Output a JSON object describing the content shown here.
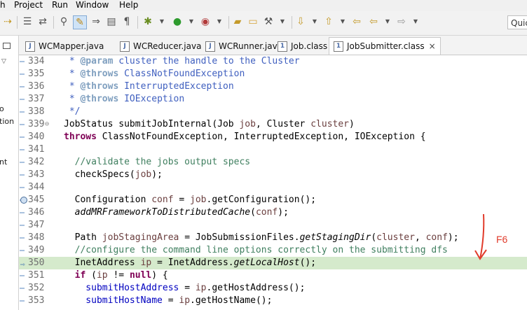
{
  "menu": [
    "h",
    "Project",
    "Run",
    "Window",
    "Help"
  ],
  "quick_access": "Quic",
  "left_fragments": [
    "o",
    "tion",
    "nt"
  ],
  "tabs": [
    {
      "label": "WCMapper.java",
      "active": false,
      "icon": "java-file-icon"
    },
    {
      "label": "WCReducer.java",
      "active": false,
      "icon": "java-file-icon"
    },
    {
      "label": "WCRunner.java",
      "active": false,
      "icon": "java-file-icon"
    },
    {
      "label": "Job.class",
      "active": false,
      "icon": "class-file-icon"
    },
    {
      "label": "JobSubmitter.class",
      "active": true,
      "icon": "class-file-icon",
      "close": "×"
    }
  ],
  "code_lines": [
    {
      "n": "334",
      "segs": [
        [
          "cmt",
          " * "
        ],
        [
          "tag",
          "@param"
        ],
        [
          "cmt",
          " cluster the handle to the Cluster"
        ]
      ]
    },
    {
      "n": "335",
      "segs": [
        [
          "cmt",
          " * "
        ],
        [
          "tag",
          "@throws"
        ],
        [
          "cmt",
          " ClassNotFoundException"
        ]
      ]
    },
    {
      "n": "336",
      "segs": [
        [
          "cmt",
          " * "
        ],
        [
          "tag",
          "@throws"
        ],
        [
          "cmt",
          " InterruptedException"
        ]
      ]
    },
    {
      "n": "337",
      "segs": [
        [
          "cmt",
          " * "
        ],
        [
          "tag",
          "@throws"
        ],
        [
          "cmt",
          " IOException"
        ]
      ]
    },
    {
      "n": "338",
      "segs": [
        [
          "cmt",
          " */"
        ]
      ]
    },
    {
      "n": "339",
      "fold": "⊖",
      "segs": [
        [
          "",
          "JobStatus submitJobInternal(Job "
        ],
        [
          "var",
          "job"
        ],
        [
          "",
          ", Cluster "
        ],
        [
          "var",
          "cluster"
        ],
        [
          "",
          ")"
        ]
      ]
    },
    {
      "n": "340",
      "segs": [
        [
          "kw",
          "throws"
        ],
        [
          "",
          " ClassNotFoundException, InterruptedException, IOException {"
        ]
      ]
    },
    {
      "n": "341",
      "segs": []
    },
    {
      "n": "342",
      "segs": [
        [
          "gc",
          "  //validate the jobs output specs"
        ]
      ]
    },
    {
      "n": "343",
      "segs": [
        [
          "",
          "  checkSpecs("
        ],
        [
          "var",
          "job"
        ],
        [
          "",
          ");"
        ]
      ]
    },
    {
      "n": "344",
      "segs": []
    },
    {
      "n": "345",
      "marker": "bp",
      "segs": [
        [
          "",
          "  Configuration "
        ],
        [
          "var",
          "conf"
        ],
        [
          "",
          " = "
        ],
        [
          "var",
          "job"
        ],
        [
          "",
          ".getConfiguration();"
        ]
      ]
    },
    {
      "n": "346",
      "segs": [
        [
          "it",
          "  addMRFrameworkToDistributedCache"
        ],
        [
          "",
          "("
        ],
        [
          "var",
          "conf"
        ],
        [
          "",
          ");"
        ]
      ]
    },
    {
      "n": "347",
      "segs": []
    },
    {
      "n": "348",
      "segs": [
        [
          "",
          "  Path "
        ],
        [
          "var",
          "jobStagingArea"
        ],
        [
          "",
          " = JobSubmissionFiles."
        ],
        [
          "it",
          "getStagingDir"
        ],
        [
          "",
          "("
        ],
        [
          "var",
          "cluster"
        ],
        [
          "",
          ", "
        ],
        [
          "var",
          "conf"
        ],
        [
          "",
          ");"
        ]
      ]
    },
    {
      "n": "349",
      "segs": [
        [
          "gc",
          "  //configure the command line options correctly on the submitting dfs"
        ]
      ]
    },
    {
      "n": "350",
      "hl": true,
      "marker": "ptr",
      "segs": [
        [
          "",
          "  InetAddress "
        ],
        [
          "var",
          "ip"
        ],
        [
          "",
          " = InetAddress."
        ],
        [
          "it",
          "getLocalHost"
        ],
        [
          "",
          "();"
        ]
      ]
    },
    {
      "n": "351",
      "segs": [
        [
          "kw",
          "  if"
        ],
        [
          "",
          " ("
        ],
        [
          "var",
          "ip"
        ],
        [
          "",
          " != "
        ],
        [
          "kw",
          "null"
        ],
        [
          "",
          ") {"
        ]
      ]
    },
    {
      "n": "352",
      "segs": [
        [
          "fld",
          "    submitHostAddress"
        ],
        [
          "",
          " = "
        ],
        [
          "var",
          "ip"
        ],
        [
          "",
          ".getHostAddress();"
        ]
      ]
    },
    {
      "n": "353",
      "segs": [
        [
          "fld",
          "    submitHostName"
        ],
        [
          "",
          " = "
        ],
        [
          "var",
          "ip"
        ],
        [
          "",
          ".getHostName();"
        ]
      ]
    }
  ],
  "annotation": {
    "label": "F6",
    "color": "#e13c2c"
  }
}
